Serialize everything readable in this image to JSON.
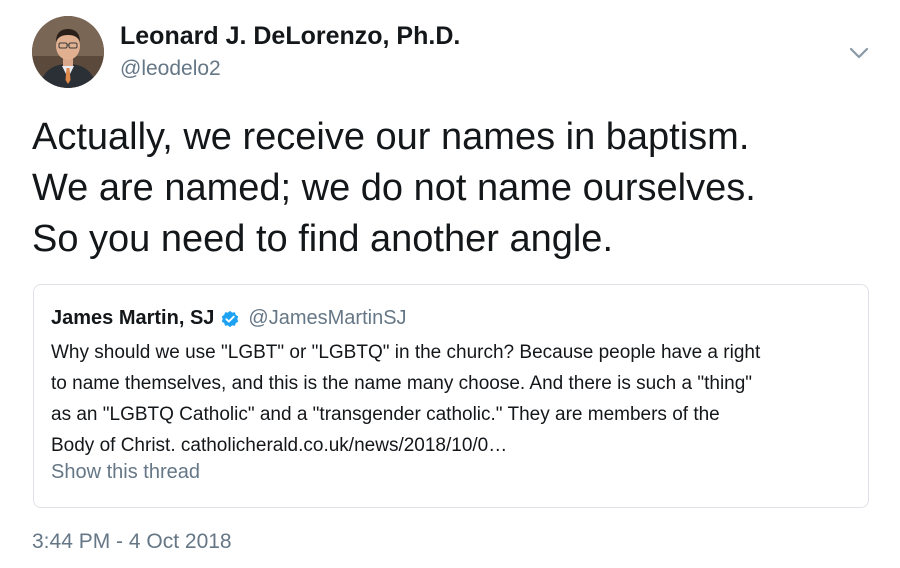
{
  "tweet": {
    "author": {
      "display_name": "Leonard J. DeLorenzo, Ph.D.",
      "handle": "@leodelo2",
      "avatar_icon": "profile-photo"
    },
    "menu_icon": "chevron-down-icon",
    "text_lines": [
      "Actually, we receive our names in baptism.",
      "We are named; we do not name ourselves.",
      "So you need to find another angle."
    ],
    "timestamp": "3:44 PM - 4 Oct 2018"
  },
  "quoted_tweet": {
    "display_name": "James Martin, SJ",
    "verified": true,
    "verified_icon": "verified-badge-icon",
    "handle": "@JamesMartinSJ",
    "text_lines": [
      "Why should we use \"LGBT\" or \"LGBTQ\" in the church? Because people have a right",
      "to name themselves, and this is the name many choose. And there is such a \"thing\"",
      "as an \"LGBTQ Catholic\" and a \"transgender catholic.\" They are members of the",
      "Body of Christ. catholicherald.co.uk/news/2018/10/0…"
    ],
    "show_thread_label": "Show this thread"
  },
  "colors": {
    "text_primary": "#14171a",
    "text_secondary": "#657786",
    "border": "#dfe3e8",
    "verified_blue": "#1da1f2"
  }
}
